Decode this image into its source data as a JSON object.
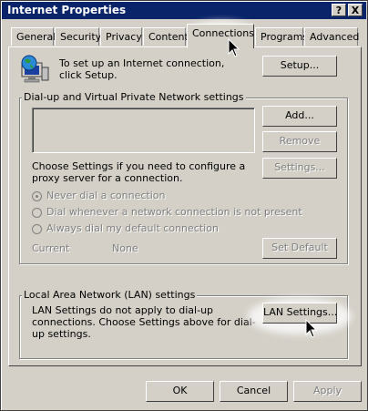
{
  "window": {
    "title": "Internet Properties",
    "help_label": "?",
    "close_label": "X"
  },
  "tabs": [
    {
      "label": "General"
    },
    {
      "label": "Security"
    },
    {
      "label": "Privacy"
    },
    {
      "label": "Content"
    },
    {
      "label": "Connections",
      "active": true
    },
    {
      "label": "Programs"
    },
    {
      "label": "Advanced"
    }
  ],
  "setup": {
    "text": "To set up an Internet connection, click Setup.",
    "button": "Setup..."
  },
  "dialup": {
    "group_label": "Dial-up and Virtual Private Network settings",
    "add": "Add...",
    "remove": "Remove",
    "settings": "Settings...",
    "info": "Choose Settings if you need to configure a proxy server for a connection.",
    "options": [
      {
        "label": "Never dial a connection",
        "checked": true
      },
      {
        "label": "Dial whenever a network connection is not present",
        "checked": false
      },
      {
        "label": "Always dial my default connection",
        "checked": false
      }
    ],
    "current_label": "Current",
    "current_value": "None",
    "set_default": "Set Default"
  },
  "lan": {
    "group_label": "Local Area Network (LAN) settings",
    "text": "LAN Settings do not apply to dial-up connections. Choose Settings above for dial-up settings.",
    "button": "LAN Settings..."
  },
  "footer": {
    "ok": "OK",
    "cancel": "Cancel",
    "apply": "Apply"
  },
  "icons": {
    "connection": "globe-computer-icon",
    "cursor": "mouse-pointer-icon"
  }
}
